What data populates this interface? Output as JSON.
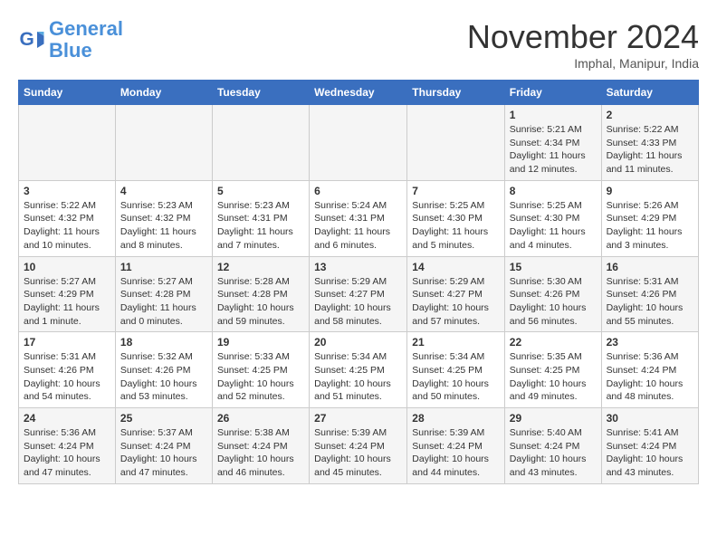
{
  "logo": {
    "line1": "General",
    "line2": "Blue"
  },
  "title": "November 2024",
  "subtitle": "Imphal, Manipur, India",
  "headers": [
    "Sunday",
    "Monday",
    "Tuesday",
    "Wednesday",
    "Thursday",
    "Friday",
    "Saturday"
  ],
  "weeks": [
    [
      {
        "day": "",
        "info": ""
      },
      {
        "day": "",
        "info": ""
      },
      {
        "day": "",
        "info": ""
      },
      {
        "day": "",
        "info": ""
      },
      {
        "day": "",
        "info": ""
      },
      {
        "day": "1",
        "info": "Sunrise: 5:21 AM\nSunset: 4:34 PM\nDaylight: 11 hours and 12 minutes."
      },
      {
        "day": "2",
        "info": "Sunrise: 5:22 AM\nSunset: 4:33 PM\nDaylight: 11 hours and 11 minutes."
      }
    ],
    [
      {
        "day": "3",
        "info": "Sunrise: 5:22 AM\nSunset: 4:32 PM\nDaylight: 11 hours and 10 minutes."
      },
      {
        "day": "4",
        "info": "Sunrise: 5:23 AM\nSunset: 4:32 PM\nDaylight: 11 hours and 8 minutes."
      },
      {
        "day": "5",
        "info": "Sunrise: 5:23 AM\nSunset: 4:31 PM\nDaylight: 11 hours and 7 minutes."
      },
      {
        "day": "6",
        "info": "Sunrise: 5:24 AM\nSunset: 4:31 PM\nDaylight: 11 hours and 6 minutes."
      },
      {
        "day": "7",
        "info": "Sunrise: 5:25 AM\nSunset: 4:30 PM\nDaylight: 11 hours and 5 minutes."
      },
      {
        "day": "8",
        "info": "Sunrise: 5:25 AM\nSunset: 4:30 PM\nDaylight: 11 hours and 4 minutes."
      },
      {
        "day": "9",
        "info": "Sunrise: 5:26 AM\nSunset: 4:29 PM\nDaylight: 11 hours and 3 minutes."
      }
    ],
    [
      {
        "day": "10",
        "info": "Sunrise: 5:27 AM\nSunset: 4:29 PM\nDaylight: 11 hours and 1 minute."
      },
      {
        "day": "11",
        "info": "Sunrise: 5:27 AM\nSunset: 4:28 PM\nDaylight: 11 hours and 0 minutes."
      },
      {
        "day": "12",
        "info": "Sunrise: 5:28 AM\nSunset: 4:28 PM\nDaylight: 10 hours and 59 minutes."
      },
      {
        "day": "13",
        "info": "Sunrise: 5:29 AM\nSunset: 4:27 PM\nDaylight: 10 hours and 58 minutes."
      },
      {
        "day": "14",
        "info": "Sunrise: 5:29 AM\nSunset: 4:27 PM\nDaylight: 10 hours and 57 minutes."
      },
      {
        "day": "15",
        "info": "Sunrise: 5:30 AM\nSunset: 4:26 PM\nDaylight: 10 hours and 56 minutes."
      },
      {
        "day": "16",
        "info": "Sunrise: 5:31 AM\nSunset: 4:26 PM\nDaylight: 10 hours and 55 minutes."
      }
    ],
    [
      {
        "day": "17",
        "info": "Sunrise: 5:31 AM\nSunset: 4:26 PM\nDaylight: 10 hours and 54 minutes."
      },
      {
        "day": "18",
        "info": "Sunrise: 5:32 AM\nSunset: 4:26 PM\nDaylight: 10 hours and 53 minutes."
      },
      {
        "day": "19",
        "info": "Sunrise: 5:33 AM\nSunset: 4:25 PM\nDaylight: 10 hours and 52 minutes."
      },
      {
        "day": "20",
        "info": "Sunrise: 5:34 AM\nSunset: 4:25 PM\nDaylight: 10 hours and 51 minutes."
      },
      {
        "day": "21",
        "info": "Sunrise: 5:34 AM\nSunset: 4:25 PM\nDaylight: 10 hours and 50 minutes."
      },
      {
        "day": "22",
        "info": "Sunrise: 5:35 AM\nSunset: 4:25 PM\nDaylight: 10 hours and 49 minutes."
      },
      {
        "day": "23",
        "info": "Sunrise: 5:36 AM\nSunset: 4:24 PM\nDaylight: 10 hours and 48 minutes."
      }
    ],
    [
      {
        "day": "24",
        "info": "Sunrise: 5:36 AM\nSunset: 4:24 PM\nDaylight: 10 hours and 47 minutes."
      },
      {
        "day": "25",
        "info": "Sunrise: 5:37 AM\nSunset: 4:24 PM\nDaylight: 10 hours and 47 minutes."
      },
      {
        "day": "26",
        "info": "Sunrise: 5:38 AM\nSunset: 4:24 PM\nDaylight: 10 hours and 46 minutes."
      },
      {
        "day": "27",
        "info": "Sunrise: 5:39 AM\nSunset: 4:24 PM\nDaylight: 10 hours and 45 minutes."
      },
      {
        "day": "28",
        "info": "Sunrise: 5:39 AM\nSunset: 4:24 PM\nDaylight: 10 hours and 44 minutes."
      },
      {
        "day": "29",
        "info": "Sunrise: 5:40 AM\nSunset: 4:24 PM\nDaylight: 10 hours and 43 minutes."
      },
      {
        "day": "30",
        "info": "Sunrise: 5:41 AM\nSunset: 4:24 PM\nDaylight: 10 hours and 43 minutes."
      }
    ]
  ]
}
